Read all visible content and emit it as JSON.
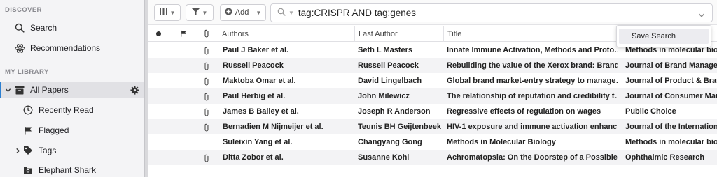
{
  "sidebar": {
    "discover_title": "DISCOVER",
    "discover_items": [
      {
        "label": "Search",
        "icon": "search-icon"
      },
      {
        "label": "Recommendations",
        "icon": "atom-icon"
      }
    ],
    "library_title": "MY LIBRARY",
    "library_items": [
      {
        "label": "All Papers",
        "icon": "archive-box-icon",
        "active": true
      },
      {
        "label": "Recently Read",
        "icon": "clock-icon"
      },
      {
        "label": "Flagged",
        "icon": "flag-icon"
      },
      {
        "label": "Tags",
        "icon": "tag-icon"
      },
      {
        "label": "Elephant Shark",
        "icon": "folder-icon"
      }
    ]
  },
  "toolbar": {
    "add_label": "Add",
    "search_query": "tag:CRISPR AND tag:genes"
  },
  "table": {
    "columns": {
      "authors": "Authors",
      "last_author": "Last Author",
      "title": "Title"
    },
    "rows": [
      {
        "attachment": true,
        "authors": "Paul J Baker et al.",
        "last_author": "Seth L Masters",
        "title": "Innate Immune Activation, Methods and Proto…",
        "journal": "Methods in molecular biol"
      },
      {
        "attachment": true,
        "authors": "Russell Peacock",
        "last_author": "Russell Peacock",
        "title": "Rebuilding the value of the Xerox brand: Brand…",
        "journal": "Journal of Brand Manager"
      },
      {
        "attachment": true,
        "authors": "Maktoba Omar et al.",
        "last_author": "David Lingelbach",
        "title": "Global brand market-entry strategy to manage…",
        "journal": "Journal of Product & Bran"
      },
      {
        "attachment": true,
        "authors": "Paul Herbig et al.",
        "last_author": "John Milewicz",
        "title": "The relationship of reputation and credibility t…",
        "journal": "Journal of Consumer Mark"
      },
      {
        "attachment": true,
        "authors": "James B Bailey et al.",
        "last_author": "Joseph R Anderson",
        "title": "Regressive effects of regulation on wages",
        "journal": "Public Choice"
      },
      {
        "attachment": true,
        "authors": "Bernadien M Nijmeijer et al.",
        "last_author": "Teunis BH Geijtenbeek",
        "title": "HIV-1 exposure and immune activation enhanc…",
        "journal": "Journal of the Internationa"
      },
      {
        "attachment": false,
        "authors": "Suleixin Yang et al.",
        "last_author": "Changyang Gong",
        "title": "Methods in Molecular Biology",
        "journal": "Methods in molecular biol"
      },
      {
        "attachment": true,
        "authors": "Ditta Zobor et al.",
        "last_author": "Susanne Kohl",
        "title": "Achromatopsia: On the Doorstep of a Possible …",
        "journal": "Ophthalmic Research"
      }
    ]
  },
  "popup": {
    "save_search_label": "Save Search"
  },
  "colors": {
    "accent": "#2c7fd1",
    "sidebar_bg": "#f4f4f6",
    "row_alt": "#f3f3f5"
  }
}
